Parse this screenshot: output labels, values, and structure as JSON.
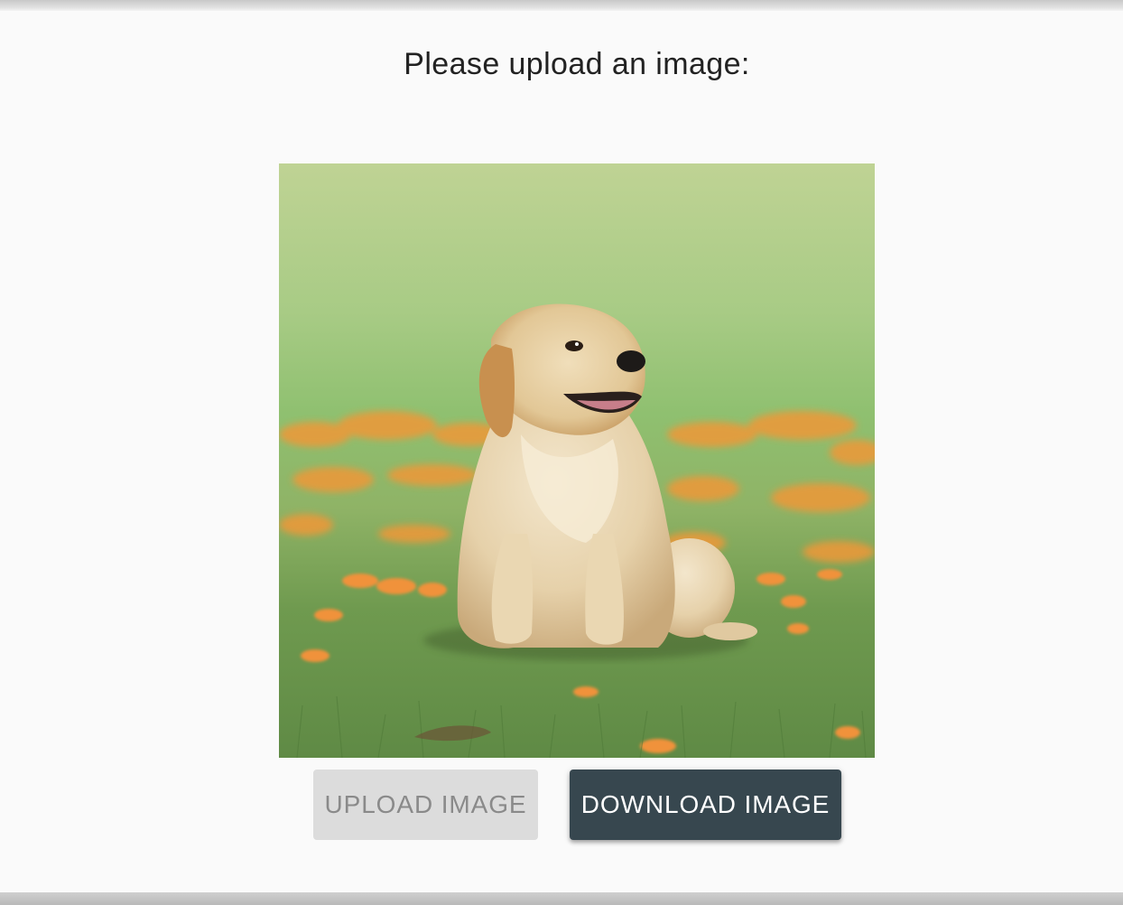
{
  "prompt_text": "Please upload an image:",
  "preview": {
    "icon": "puppy-photo",
    "colors": {
      "background_top": "#bfd394",
      "grass": "#6f9a4f",
      "flowers": "#ef9838",
      "puppy": "#e8d4b0"
    }
  },
  "buttons": {
    "upload_label": "Upload Image",
    "upload_state": "disabled",
    "download_label": "Download Image"
  },
  "colors": {
    "page_background": "#fafafa",
    "upload_button_bg": "#dcdcdc",
    "upload_button_text": "#8a8a8a",
    "download_button_bg": "#37474f",
    "download_button_text": "#ffffff"
  }
}
